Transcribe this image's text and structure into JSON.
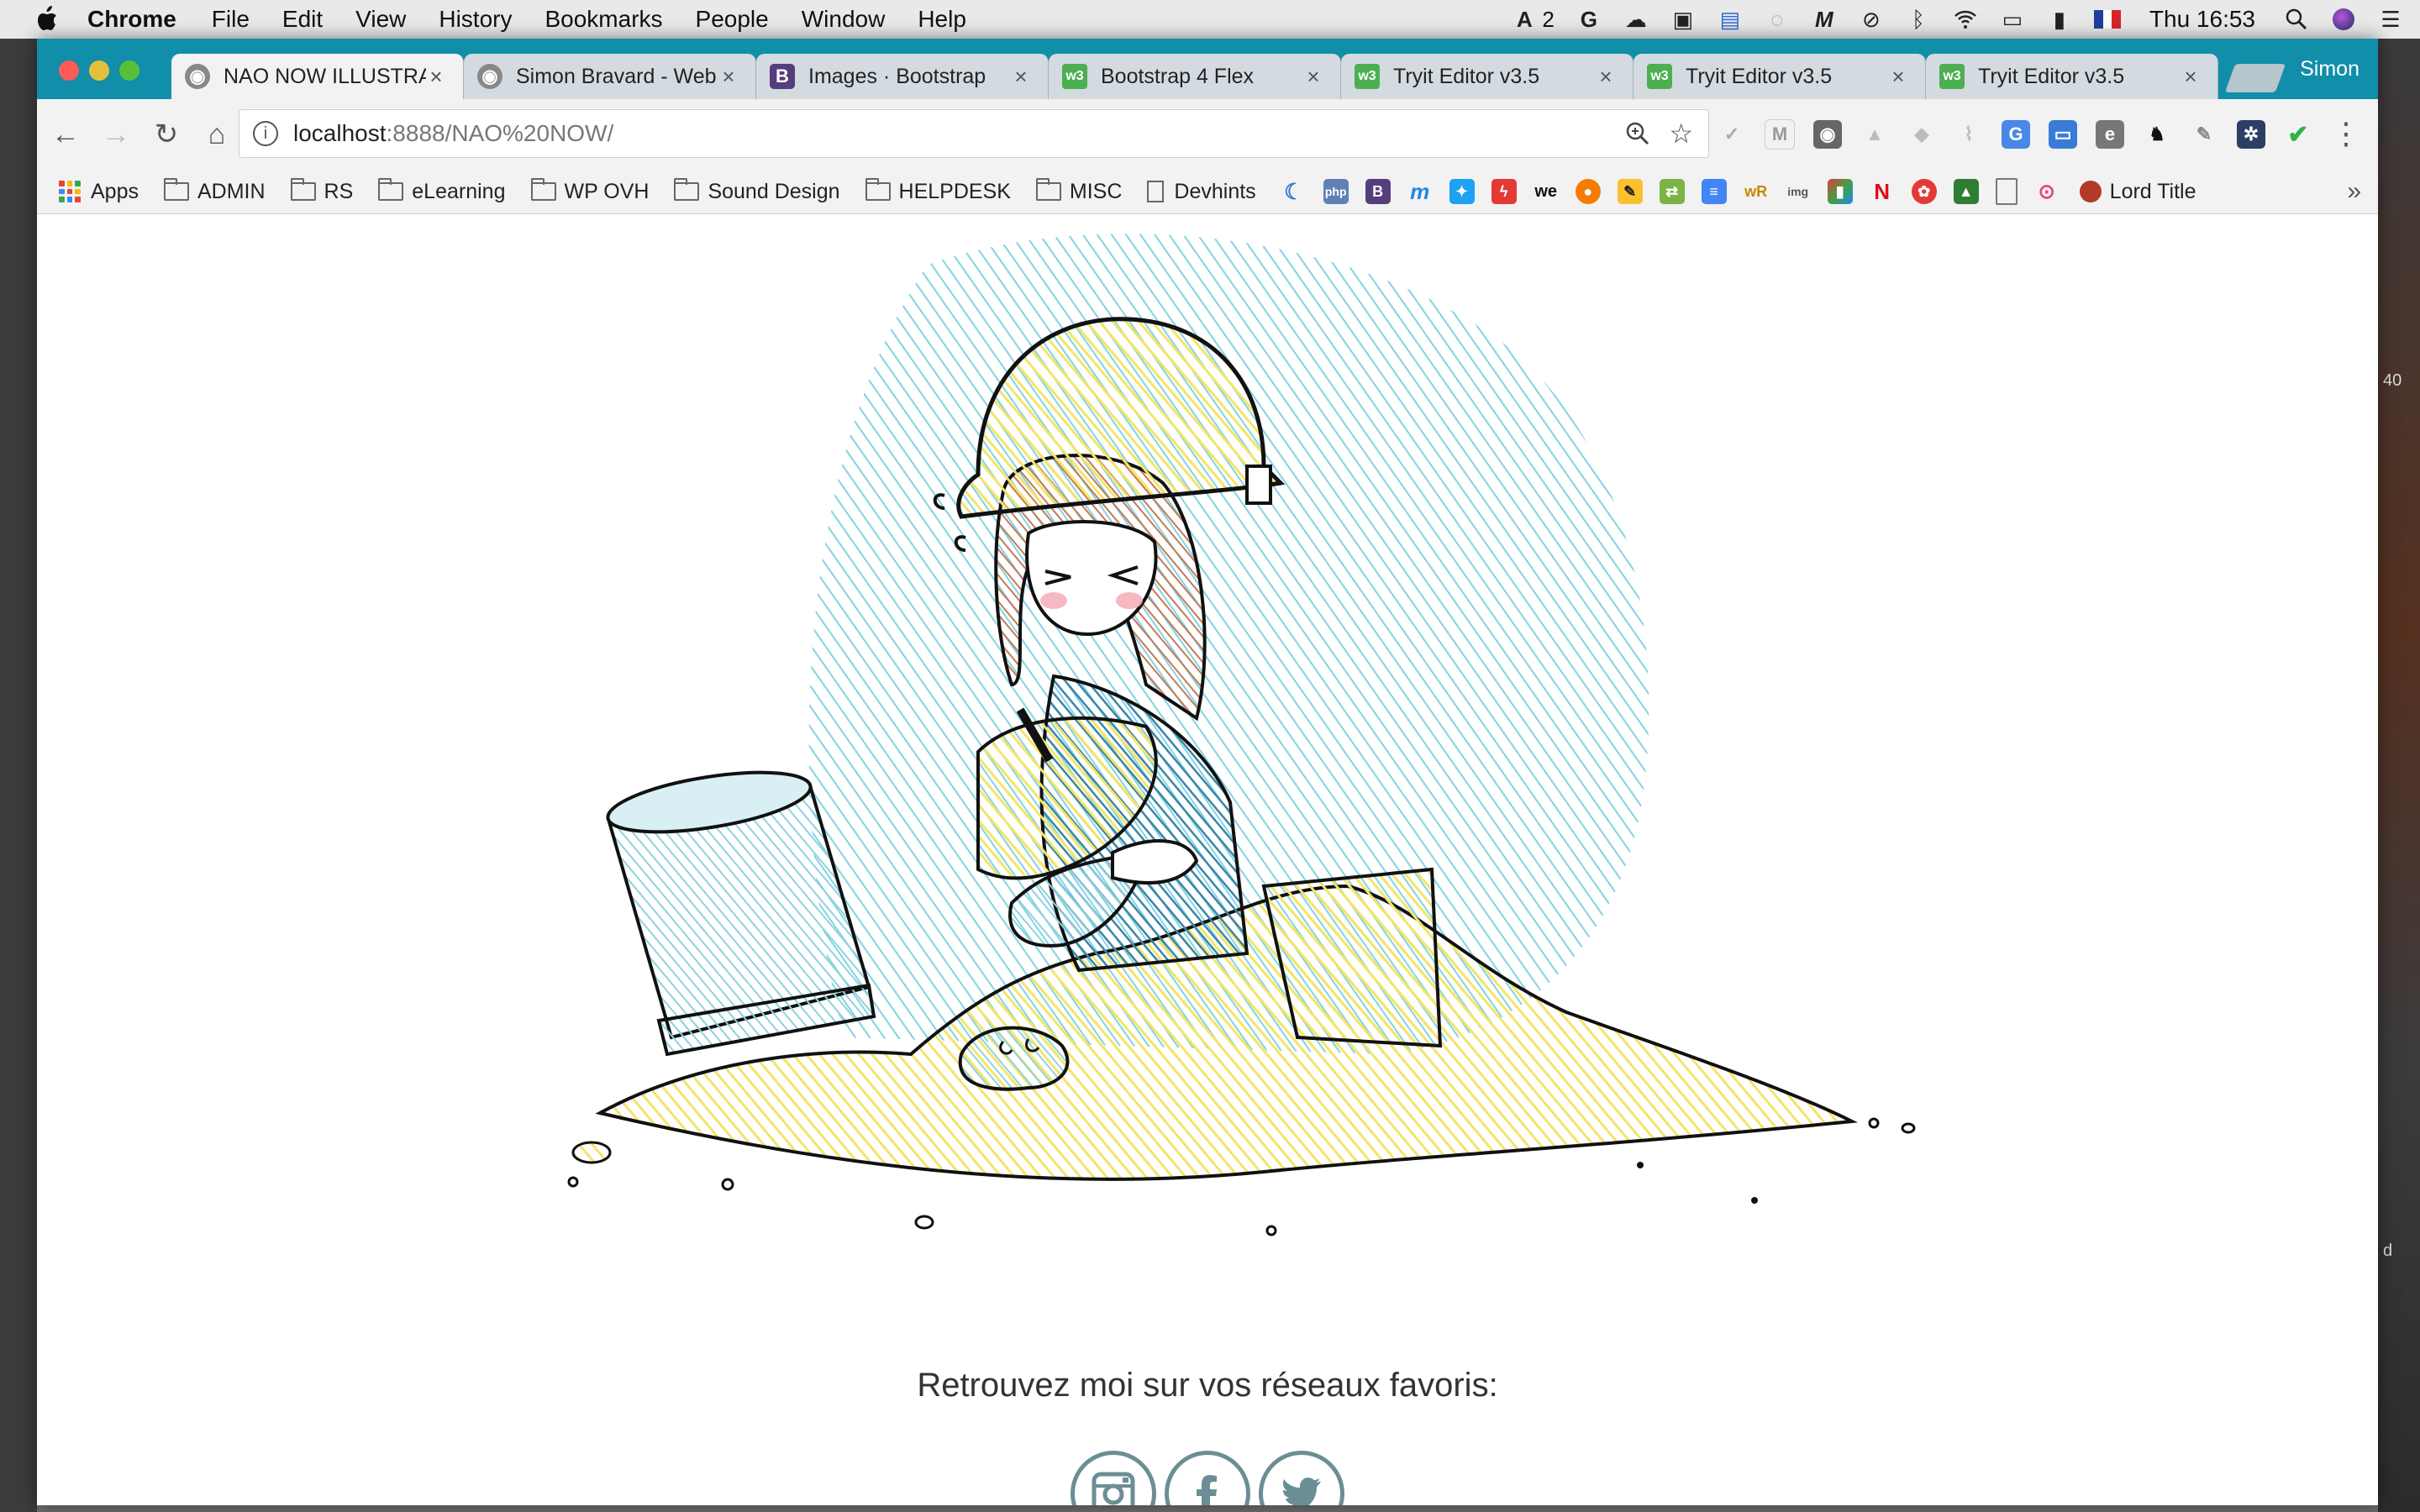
{
  "menubar": {
    "app": "Chrome",
    "items": [
      "File",
      "Edit",
      "View",
      "History",
      "Bookmarks",
      "People",
      "Window",
      "Help"
    ],
    "adobe_count": "2",
    "clock": "Thu 16:53"
  },
  "tabs": [
    {
      "title": "NAO NOW ILLUSTRATI",
      "active": true
    },
    {
      "title": "Simon Bravard - Web",
      "active": false
    },
    {
      "title": "Images · Bootstrap",
      "active": false
    },
    {
      "title": "Bootstrap 4 Flex",
      "active": false
    },
    {
      "title": "Tryit Editor v3.5",
      "active": false
    },
    {
      "title": "Tryit Editor v3.5",
      "active": false
    },
    {
      "title": "Tryit Editor v3.5",
      "active": false
    }
  ],
  "tab_close": "×",
  "profile": "Simon",
  "address": {
    "host": "localhost",
    "path": ":8888/NAO%20NOW/"
  },
  "bookmarks": {
    "apps": "Apps",
    "folders": [
      "ADMIN",
      "RS",
      "eLearning",
      "WP OVH",
      "Sound Design",
      "HELPDESK",
      "MISC"
    ],
    "devhints": "Devhints",
    "lord_title": "Lord Title",
    "icon_labels": {
      "php": "php",
      "bootstrap": "B",
      "we": "we",
      "wr": "wR",
      "img": "img"
    }
  },
  "page": {
    "social_text": "Retrouvez moi sur vos réseaux favoris:",
    "social_links": [
      "instagram",
      "facebook",
      "twitter"
    ]
  },
  "desktop": {
    "right_num": "40",
    "right_letter": "d"
  },
  "colors": {
    "tabstrip": "#118ea9",
    "social_border": "#6b8e94"
  }
}
